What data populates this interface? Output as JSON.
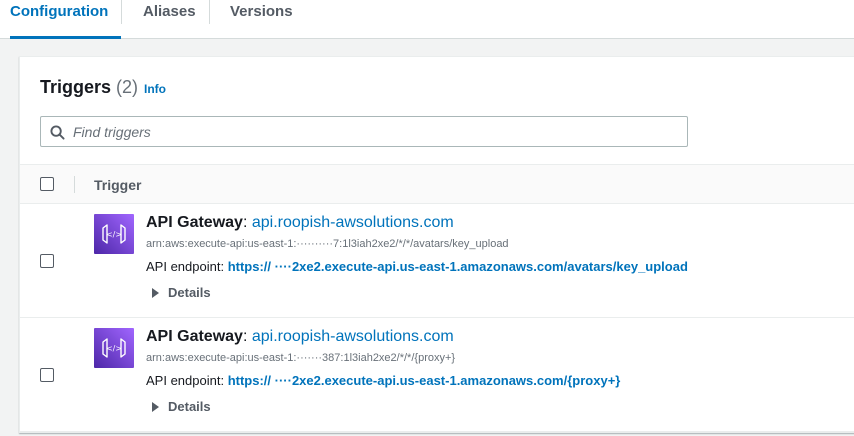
{
  "tabs": [
    {
      "label": "Configuration",
      "active": true
    },
    {
      "label": "Aliases",
      "active": false
    },
    {
      "label": "Versions",
      "active": false
    }
  ],
  "triggers": {
    "title": "Triggers",
    "count": "(2)",
    "info_label": "Info",
    "search_placeholder": "Find triggers",
    "column_header": "Trigger",
    "rows": [
      {
        "service": "API Gateway",
        "separator": ":",
        "name": "api.roopish-awsolutions.com",
        "arn": "arn:aws:execute-api:us-east-1:··········7:1l3iah2xe2/*/*/avatars/key_upload",
        "endpoint_label": "API endpoint:",
        "endpoint_url": "https:// ····2xe2.execute-api.us-east-1.amazonaws.com/avatars/key_upload",
        "details_label": "Details"
      },
      {
        "service": "API Gateway",
        "separator": ":",
        "name": "api.roopish-awsolutions.com",
        "arn": "arn:aws:execute-api:us-east-1:·······387:1l3iah2xe2/*/*/{proxy+}",
        "endpoint_label": "API endpoint:",
        "endpoint_url": "https:// ····2xe2.execute-api.us-east-1.amazonaws.com/{proxy+}",
        "details_label": "Details"
      }
    ]
  },
  "icons": {
    "search": "search-icon",
    "service": "api-gateway-icon",
    "expand": "caret-right-icon"
  },
  "colors": {
    "accent": "#0073bb",
    "api_gateway_gradient": [
      "#a166ff",
      "#4d27a8"
    ]
  }
}
